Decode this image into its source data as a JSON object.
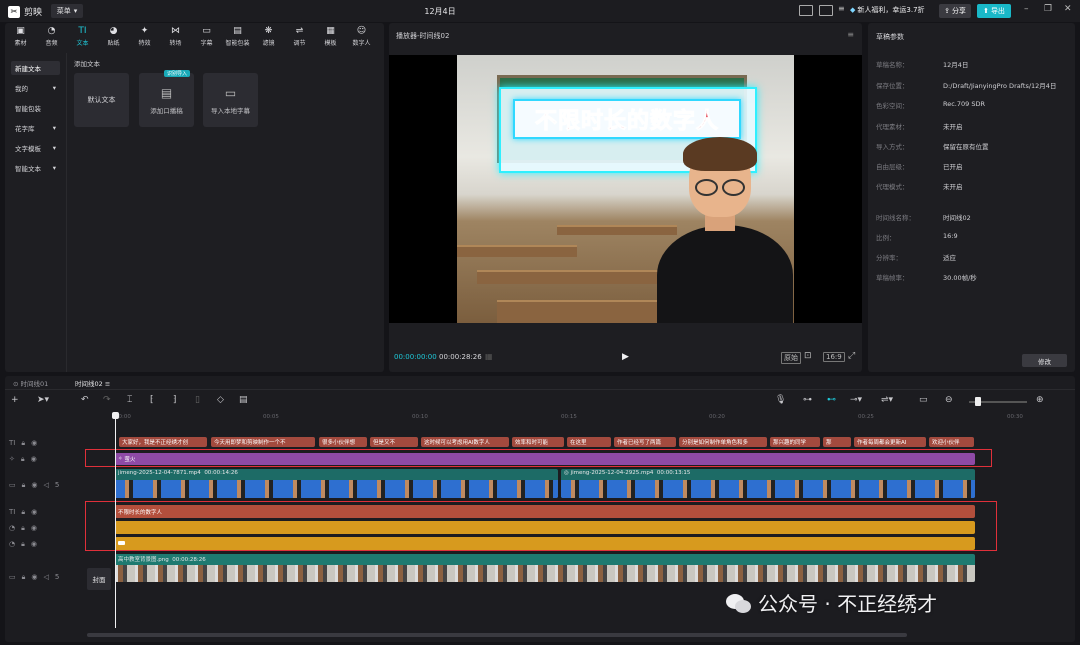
{
  "app": {
    "name": "剪映",
    "menu_label": "菜单",
    "date_title": "12月4日",
    "promo": "新人福利，幸运3.7折",
    "share_label": "分享",
    "export_label": "导出"
  },
  "toolbar": [
    {
      "icon": "media-icon",
      "label": "素材"
    },
    {
      "icon": "audio-icon",
      "label": "音频"
    },
    {
      "icon": "text-icon",
      "label": "文本"
    },
    {
      "icon": "sticker-icon",
      "label": "贴纸"
    },
    {
      "icon": "effects-icon",
      "label": "特效"
    },
    {
      "icon": "transition-icon",
      "label": "转场"
    },
    {
      "icon": "caption-icon",
      "label": "字幕"
    },
    {
      "icon": "smart-pack-icon",
      "label": "智能包装"
    },
    {
      "icon": "filter-icon",
      "label": "滤镜"
    },
    {
      "icon": "adjust-icon",
      "label": "调节"
    },
    {
      "icon": "template-icon",
      "label": "模板"
    },
    {
      "icon": "digital-human-icon",
      "label": "数字人"
    }
  ],
  "text_subnav": [
    "新建文本",
    "我的",
    "智能包装",
    "花字库",
    "文字模板",
    "智能文本"
  ],
  "add_text": {
    "section_title": "添加文本",
    "default_text": "默认文本",
    "oral_caption": "添加口播稿",
    "oral_badge": "识别导入",
    "import_caption": "导入本地字幕"
  },
  "player": {
    "title": "播放器-时间线02",
    "frame_text": "不限时长的数字人",
    "current_time": "00:00:00:00",
    "total_time": "00:00:28:26",
    "ratio_label": "16:9",
    "original_label": "原始"
  },
  "draft_params": {
    "title": "草稿参数",
    "rows": [
      {
        "k": "草稿名称：",
        "v": "12月4日"
      },
      {
        "k": "保存位置：",
        "v": "D:/Draft/JianyingPro Drafts/12月4日"
      },
      {
        "k": "色彩空间：",
        "v": "Rec.709 SDR"
      },
      {
        "k": "代理素材：",
        "v": "未开启"
      },
      {
        "k": "导入方式：",
        "v": "保留在原有位置"
      },
      {
        "k": "自由层级：",
        "v": "已开启"
      },
      {
        "k": "代理模式：",
        "v": "未开启"
      }
    ],
    "rows2": [
      {
        "k": "时间线名称：",
        "v": "时间线02"
      },
      {
        "k": "比例：",
        "v": "16:9"
      },
      {
        "k": "分辨率：",
        "v": "适应"
      },
      {
        "k": "草稿帧率：",
        "v": "30.00帧/秒"
      }
    ],
    "modify_label": "修改"
  },
  "timeline": {
    "tabs": [
      "时间线01",
      "时间线02"
    ],
    "ruler": [
      "00:00",
      "00:05",
      "00:10",
      "00:15",
      "00:20",
      "00:25",
      "00:30"
    ],
    "captions": [
      "大家好，我是不正经绣才创",
      "今天用即梦和剪映制作一个不",
      "很多小伙伴想",
      "但是又不",
      "这时候可以考虑用AI数字人",
      "效率和时可能",
      "在这里",
      "作者已经写了两篇",
      "分别是如何制作单角色和多",
      "那兴趣的同学",
      "那",
      "作者每周都会更新AI",
      "欢迎小伙伴"
    ],
    "effect_label": "萤火",
    "video1": {
      "name": "jimeng-2025-12-04-7871.mp4",
      "duration": "00:00:14:26"
    },
    "video2": {
      "name": "jimeng-2025-12-04-2925.mp4",
      "duration": "00:00:13:15"
    },
    "text_clip": "不限时长的数字人",
    "bg_clip": {
      "name": "高中教室背景图.png",
      "duration": "00:00:28:26"
    },
    "cover_label": "封面"
  },
  "watermark": "公众号 · 不正经绣才"
}
